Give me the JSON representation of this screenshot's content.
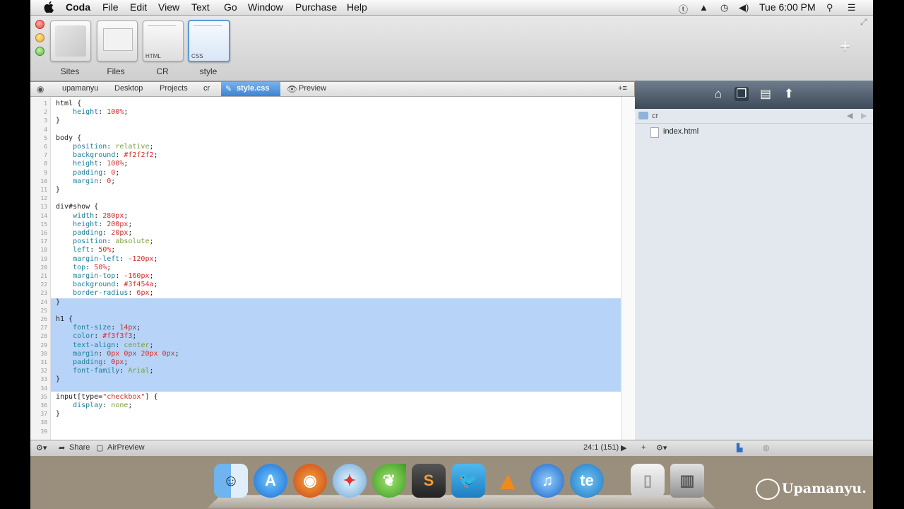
{
  "menubar": {
    "app": "Coda",
    "items": [
      "File",
      "Edit",
      "View",
      "Text",
      "Go",
      "Window",
      "Purchase",
      "Help"
    ],
    "clock": "Tue 6:00 PM"
  },
  "toolbar": {
    "tabs": [
      {
        "label": "Sites",
        "tag": ""
      },
      {
        "label": "Files",
        "tag": ""
      },
      {
        "label": "CR",
        "tag": "HTML"
      },
      {
        "label": "style",
        "tag": "CSS"
      }
    ]
  },
  "breadcrumb": {
    "items": [
      "upamanyu",
      "Desktop",
      "Projects",
      "cr"
    ],
    "active_file": "style.css",
    "preview": "Preview"
  },
  "editor": {
    "lines": [
      "html {",
      "    height: 100%;",
      "}",
      "",
      "body {",
      "    position: relative;",
      "    background: #f2f2f2;",
      "    height: 100%;",
      "    padding: 0;",
      "    margin: 0;",
      "}",
      "",
      "div#show {",
      "    width: 280px;",
      "    height: 200px;",
      "    padding: 20px;",
      "    position: absolute;",
      "    left: 50%;",
      "    margin-left: -120px;",
      "    top: 50%;",
      "    margin-top: -160px;",
      "    background: #3f454a;",
      "    border-radius: 6px;",
      "}",
      "",
      "h1 {",
      "    font-size: 14px;",
      "    color: #f3f3f3;",
      "    text-align: center;",
      "    margin: 0px 0px 20px 0px;",
      "    padding: 0px;",
      "    font-family: Arial;",
      "}",
      "",
      "input[type=\"checkbox\"] {",
      "    display: none;",
      "}",
      "",
      ""
    ]
  },
  "files": {
    "folder": "cr",
    "items": [
      "index.html"
    ]
  },
  "statusbar": {
    "share": "Share",
    "airpreview": "AirPreview",
    "cursor": "24:1 (151)"
  },
  "dock": {
    "apps": [
      "finder-icon",
      "app-store-icon",
      "firefox-icon",
      "safari-icon",
      "coda-icon",
      "sublime-icon",
      "twitter-icon",
      "vlc-icon",
      "itunes-icon",
      "te-icon",
      "downloads-icon",
      "trash-icon"
    ]
  },
  "watermark": "Upamanyu."
}
